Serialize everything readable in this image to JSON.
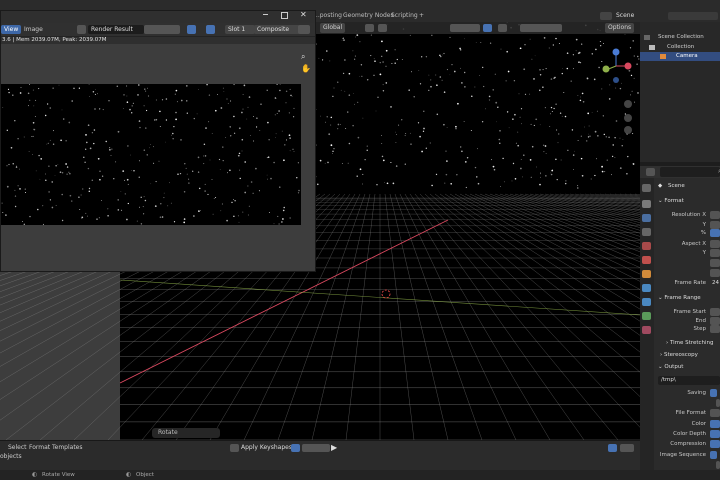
{
  "topbar": {
    "tabs": [
      "...posting",
      "Geometry Nodes",
      "Scripting",
      "+"
    ],
    "scene_label": "Scene"
  },
  "viewport": {
    "orientation": "Global",
    "options_label": "Options",
    "rotate_tip": "Rotate"
  },
  "render_window": {
    "menu_view": "View",
    "menu_image": "Image",
    "image_name": "Render Result",
    "slot": "Slot 1",
    "layer": "Composite",
    "stats": "3.6 | Mem 2039.07M, Peak: 2039.07M"
  },
  "outliner": {
    "items": [
      {
        "label": "Scene Collection",
        "depth": 0
      },
      {
        "label": "Collection",
        "depth": 1
      },
      {
        "label": "Camera",
        "depth": 2
      }
    ]
  },
  "properties": {
    "search_placeholder": "",
    "context": "Scene",
    "format_section": "Format",
    "resolution_x": "Resolution X",
    "y_label": "Y",
    "pct_label": "%",
    "aspect_x": "Aspect X",
    "aspect_y": "Y",
    "frame_rate_label": "Frame Rate",
    "frame_rate_value": "24",
    "frame_range_section": "Frame Range",
    "frame_start": "Frame Start",
    "end_label": "End",
    "step_label": "Step",
    "time_stretching": "Time Stretching",
    "stereoscopy": "Stereoscopy",
    "output_section": "Output",
    "output_path": "/tmp\\",
    "saving": "Saving",
    "file_format": "File Format",
    "color": "Color",
    "color_depth": "Color Depth",
    "compression": "Compression",
    "image_sequence": "Image Sequence"
  },
  "timeline": {
    "menus": [
      "Select",
      "Format",
      "Templates"
    ],
    "action": "Apply Keyshapes",
    "objects_text": "objects"
  },
  "statusbar": {
    "item1": "Rotate View",
    "item2": "Object"
  },
  "colors": {
    "accent_blue": "#4772b3",
    "grid": "#8a8a8a",
    "x_axis": "#d9485f",
    "y_axis": "#8fb04a"
  }
}
